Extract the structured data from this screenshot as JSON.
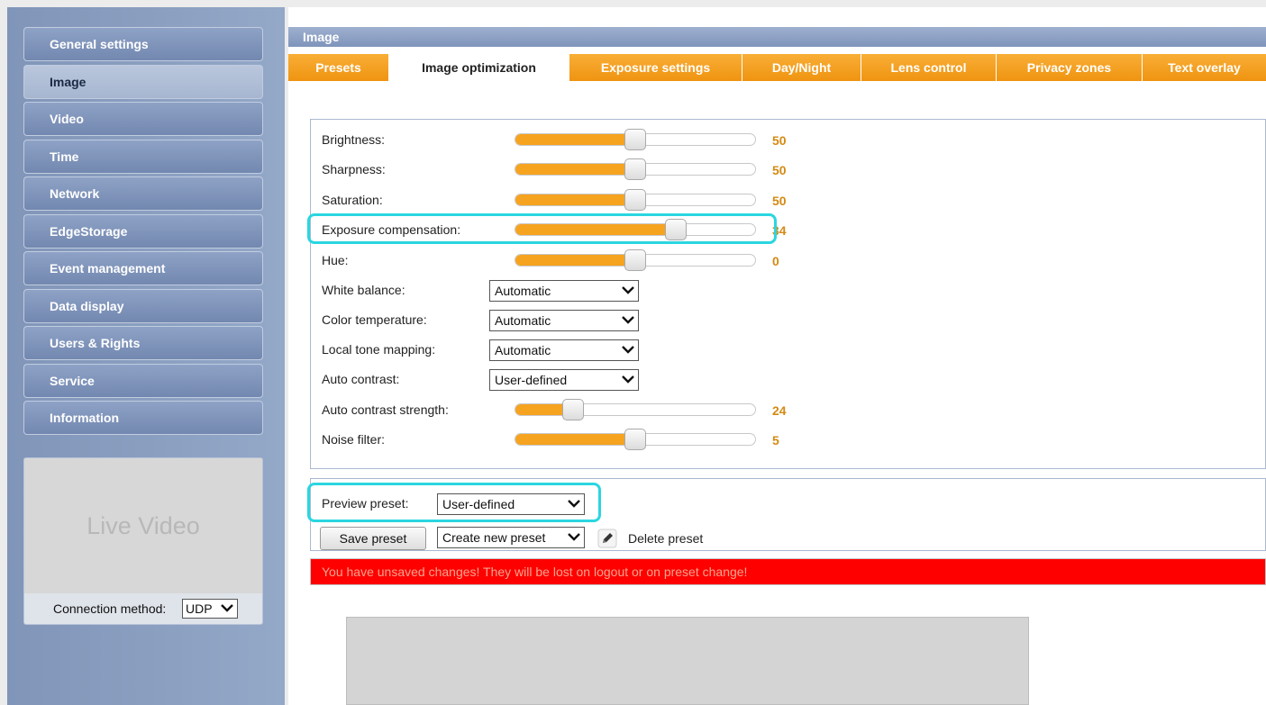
{
  "sidebar": {
    "items": [
      {
        "label": "General settings"
      },
      {
        "label": "Image"
      },
      {
        "label": "Video"
      },
      {
        "label": "Time"
      },
      {
        "label": "Network"
      },
      {
        "label": "EdgeStorage"
      },
      {
        "label": "Event management"
      },
      {
        "label": "Data display"
      },
      {
        "label": "Users & Rights"
      },
      {
        "label": "Service"
      },
      {
        "label": "Information"
      }
    ],
    "active_item": "Image",
    "live_video_label": "Live Video",
    "connection_label": "Connection method:",
    "connection_value": "UDP"
  },
  "header": {
    "title": "Image"
  },
  "tabs": [
    {
      "label": "Presets"
    },
    {
      "label": "Image optimization"
    },
    {
      "label": "Exposure settings"
    },
    {
      "label": "Day/Night"
    },
    {
      "label": "Lens control"
    },
    {
      "label": "Privacy zones"
    },
    {
      "label": "Text overlay"
    }
  ],
  "active_tab": "Image optimization",
  "sliders": [
    {
      "label": "Brightness:",
      "value": "50",
      "fill": 0.5
    },
    {
      "label": "Sharpness:",
      "value": "50",
      "fill": 0.5
    },
    {
      "label": "Saturation:",
      "value": "50",
      "fill": 0.5
    },
    {
      "label": "Exposure compensation:",
      "value": "34",
      "fill": 0.67
    },
    {
      "label": "Hue:",
      "value": "0",
      "fill": 0.5
    }
  ],
  "selects": [
    {
      "label": "White balance:",
      "value": "Automatic"
    },
    {
      "label": "Color temperature:",
      "value": "Automatic"
    },
    {
      "label": "Local tone mapping:",
      "value": "Automatic"
    },
    {
      "label": "Auto contrast:",
      "value": "User-defined"
    }
  ],
  "extra_sliders": [
    {
      "label": "Auto contrast strength:",
      "value": "24",
      "fill": 0.24
    },
    {
      "label": "Noise filter:",
      "value": "5",
      "fill": 0.5
    }
  ],
  "preset": {
    "label": "Preview preset:",
    "value": "User-defined",
    "save_label": "Save preset",
    "create_value": "Create new preset",
    "delete_label": "Delete preset"
  },
  "warning": "You have unsaved changes! They will be lost on logout or on preset change!",
  "colors": {
    "accent": "#f6a320",
    "highlight": "#2ad6e0",
    "warning": "#ff0000",
    "value_text": "#d48a13"
  }
}
